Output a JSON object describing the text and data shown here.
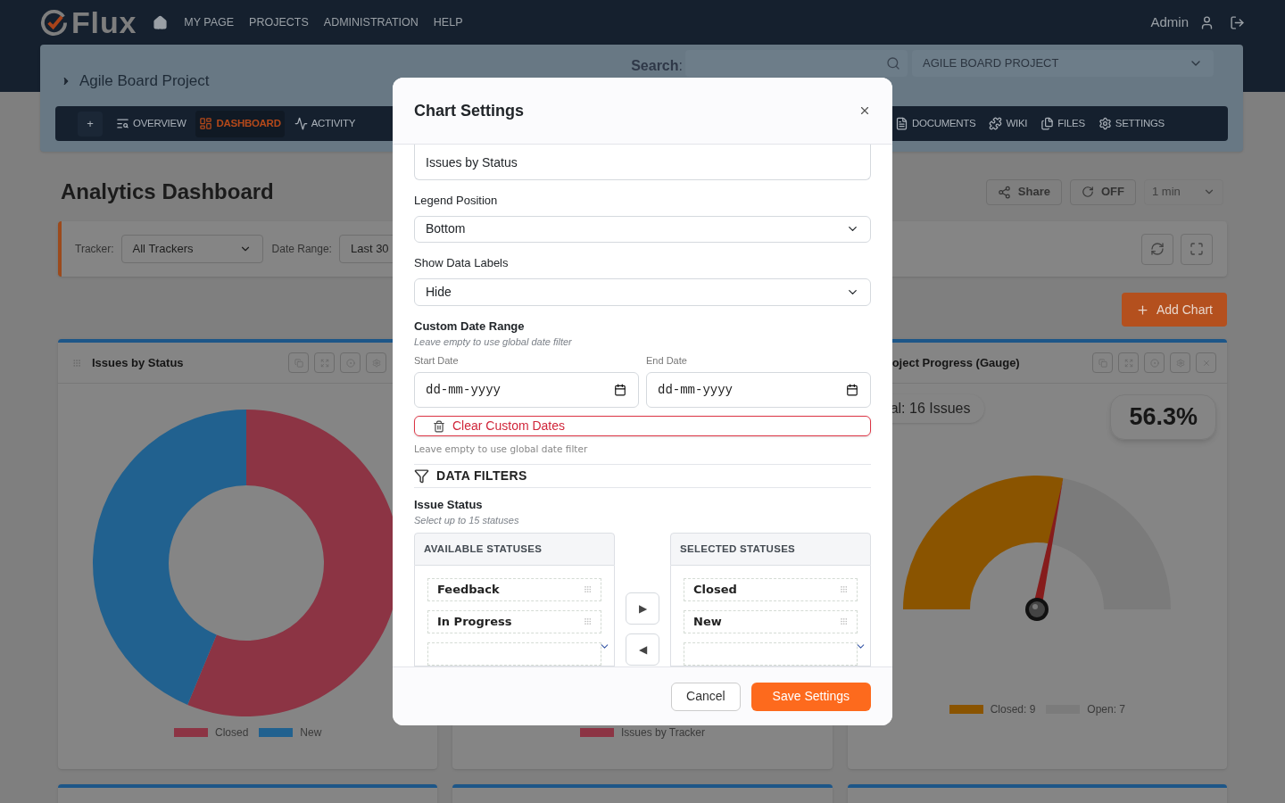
{
  "header": {
    "logo": "Flux",
    "nav": [
      "MY PAGE",
      "PROJECTS",
      "ADMINISTRATION",
      "HELP"
    ],
    "user": "Admin"
  },
  "project": {
    "title": "Agile Board Project",
    "search_label": "**Search**:",
    "project_select": "AGILE BOARD PROJECT",
    "tabs": [
      {
        "label": "+",
        "kind": "add",
        "selected": false
      },
      {
        "label": "OVERVIEW",
        "kind": "overview",
        "selected": false
      },
      {
        "label": "DASHBOARD",
        "kind": "dashboard",
        "selected": true
      },
      {
        "label": "ACTIVITY",
        "kind": "activity",
        "selected": false
      },
      {
        "label": "DOCUMENTS",
        "kind": "documents",
        "selected": false
      },
      {
        "label": "WIKI",
        "kind": "wiki",
        "selected": false
      },
      {
        "label": "FILES",
        "kind": "files",
        "selected": false
      },
      {
        "label": "SETTINGS",
        "kind": "settings",
        "selected": false
      }
    ]
  },
  "dashboard": {
    "title": "Analytics Dashboard",
    "share": "Share",
    "auto_refresh": "OFF",
    "interval": "1 min",
    "filters": {
      "tracker_label": "Tracker:",
      "tracker": "All Trackers",
      "date_label": "Date Range:",
      "date_range": "Last 30"
    },
    "add_chart": "Add Chart",
    "cards": [
      {
        "kind": "donut",
        "title": "Issues by Status",
        "legend": [
          {
            "label": "Closed",
            "color": "#8c3444"
          },
          {
            "label": "New",
            "color": "#21618f"
          }
        ]
      },
      {
        "kind": "bar",
        "legend": [
          {
            "label": "Issues by Tracker",
            "color": "#8c3444"
          }
        ]
      },
      {
        "kind": "gauge",
        "title": "oject Progress (Gauge)",
        "total": "al: 16 Issues",
        "percent": "56.3%",
        "level": 0.563,
        "legend": [
          {
            "label": "Closed: 9",
            "color": "#8a5400"
          },
          {
            "label": "Open: 7",
            "color": "#7b7b7b"
          }
        ]
      }
    ]
  },
  "dialog": {
    "title": "Chart Settings",
    "chart_title": "Issues by Status",
    "legend_label": "Legend Position",
    "legend_value": "Bottom",
    "labels_label": "Show Data Labels",
    "labels_value": "Hide",
    "date_range_label": "Custom Date Range",
    "date_range_hint": "Leave empty to use global date filter",
    "start_label": "Start Date",
    "start_placeholder": "dd-mm-yyyy",
    "end_label": "End Date",
    "end_placeholder": "dd-mm-yyyy",
    "clear": "Clear Custom Dates",
    "clear_hint": "Leave empty to use global date filter",
    "filters_heading": "DATA FILTERS",
    "status_label": "Issue Status",
    "status_hint": "Select up to 15 statuses",
    "available": {
      "heading": "AVAILABLE STATUSES",
      "items": [
        "Feedback",
        "In Progress"
      ]
    },
    "selected": {
      "heading": "SELECTED STATUSES",
      "items": [
        "Closed",
        "New"
      ]
    },
    "move_right": "▶",
    "move_left": "◀",
    "cancel": "Cancel",
    "save": "Save Settings"
  }
}
